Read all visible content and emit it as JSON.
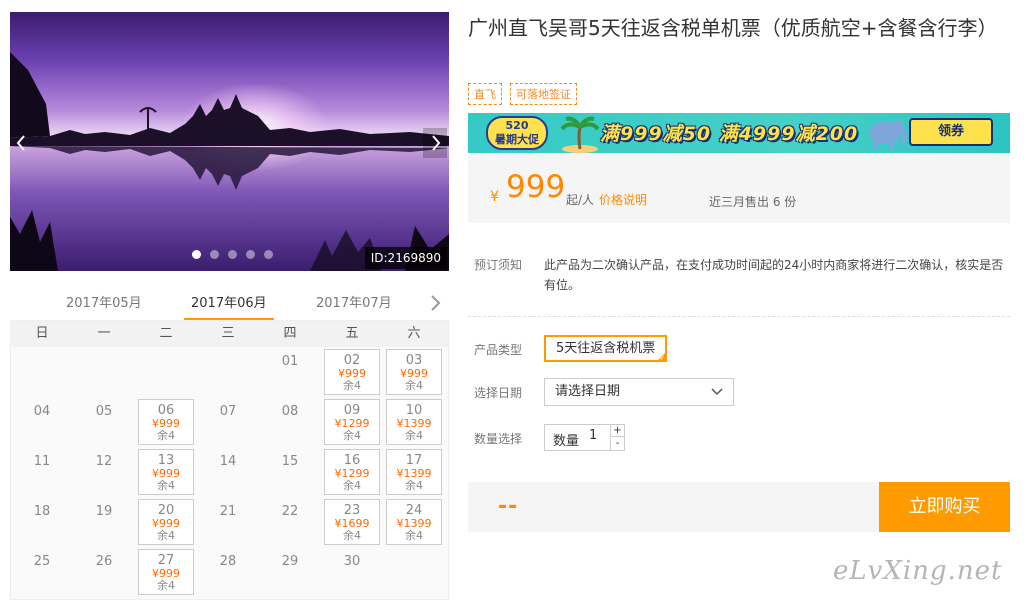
{
  "gallery": {
    "photo_id": "ID:2169890",
    "dots": [
      true,
      false,
      false,
      false,
      false
    ]
  },
  "calendar": {
    "months": [
      "2017年05月",
      "2017年06月",
      "2017年07月"
    ],
    "active_month_index": 1,
    "weekdays": [
      "日",
      "一",
      "二",
      "三",
      "四",
      "五",
      "六"
    ],
    "cells": [
      {
        "day": "",
        "price": "",
        "stock": ""
      },
      {
        "day": "",
        "price": "",
        "stock": ""
      },
      {
        "day": "",
        "price": "",
        "stock": ""
      },
      {
        "day": "",
        "price": "",
        "stock": ""
      },
      {
        "day": "01",
        "price": "",
        "stock": ""
      },
      {
        "day": "02",
        "price": "¥999",
        "stock": "余4"
      },
      {
        "day": "03",
        "price": "¥999",
        "stock": "余4"
      },
      {
        "day": "04",
        "price": "",
        "stock": ""
      },
      {
        "day": "05",
        "price": "",
        "stock": ""
      },
      {
        "day": "06",
        "price": "¥999",
        "stock": "余4"
      },
      {
        "day": "07",
        "price": "",
        "stock": ""
      },
      {
        "day": "08",
        "price": "",
        "stock": ""
      },
      {
        "day": "09",
        "price": "¥1299",
        "stock": "余4"
      },
      {
        "day": "10",
        "price": "¥1399",
        "stock": "余4"
      },
      {
        "day": "11",
        "price": "",
        "stock": ""
      },
      {
        "day": "12",
        "price": "",
        "stock": ""
      },
      {
        "day": "13",
        "price": "¥999",
        "stock": "余4"
      },
      {
        "day": "14",
        "price": "",
        "stock": ""
      },
      {
        "day": "15",
        "price": "",
        "stock": ""
      },
      {
        "day": "16",
        "price": "¥1299",
        "stock": "余4"
      },
      {
        "day": "17",
        "price": "¥1399",
        "stock": "余4"
      },
      {
        "day": "18",
        "price": "",
        "stock": ""
      },
      {
        "day": "19",
        "price": "",
        "stock": ""
      },
      {
        "day": "20",
        "price": "¥999",
        "stock": "余4"
      },
      {
        "day": "21",
        "price": "",
        "stock": ""
      },
      {
        "day": "22",
        "price": "",
        "stock": ""
      },
      {
        "day": "23",
        "price": "¥1699",
        "stock": "余4"
      },
      {
        "day": "24",
        "price": "¥1399",
        "stock": "余4"
      },
      {
        "day": "25",
        "price": "",
        "stock": ""
      },
      {
        "day": "26",
        "price": "",
        "stock": ""
      },
      {
        "day": "27",
        "price": "¥999",
        "stock": "余4"
      },
      {
        "day": "28",
        "price": "",
        "stock": ""
      },
      {
        "day": "29",
        "price": "",
        "stock": ""
      },
      {
        "day": "30",
        "price": "",
        "stock": ""
      }
    ]
  },
  "product": {
    "title": "广州直飞吴哥5天往返含税单机票（优质航空+含餐含行李）",
    "tags": [
      "直飞",
      "可落地签证"
    ]
  },
  "promo": {
    "badge_line1": "520",
    "badge_line2": "暑期大促",
    "deal_text": "满999减50 满4999减200",
    "button_label": "领券"
  },
  "price": {
    "currency": "¥",
    "amount": "999",
    "unit": "起/人",
    "explain_link": "价格说明",
    "sold_text": "近三月售出 6 份"
  },
  "booking": {
    "notice_label": "预订须知",
    "notice_text": "此产品为二次确认产品，在支付成功时间起的24小时内商家将进行二次确认，核实是否有位。",
    "type_label": "产品类型",
    "type_value": "5天往返含税机票",
    "date_label": "选择日期",
    "date_placeholder": "请选择日期",
    "qty_label": "数量选择",
    "qty_inner_label": "数量",
    "qty_value": "1",
    "qty_plus": "+",
    "qty_minus": "-",
    "total_text": "--",
    "buy_label": "立即购买"
  },
  "watermark": "eLvXing.net",
  "colors": {
    "accent": "#ff9a00",
    "price": "#ff8800",
    "tag": "#f08a24",
    "promo_bg": "#35c9c6"
  }
}
